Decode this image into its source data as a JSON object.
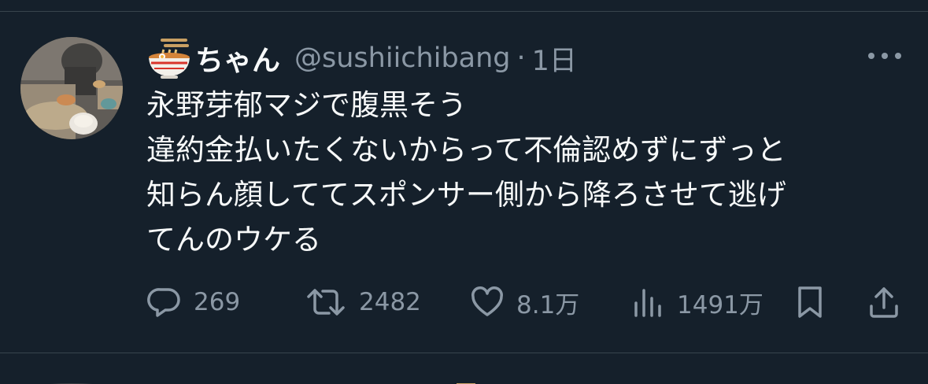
{
  "tweet": {
    "author": {
      "display_name": "ちゃん",
      "handle": "@sushiichibang",
      "name_emoji_icon": "ramen-bowl-icon"
    },
    "separator": "·",
    "time": "1日",
    "more_icon": "more-dots-icon",
    "lines": [
      "永野芽郁マジで腹黒そう",
      "違約金払いたくないからって不倫認めずにずっと",
      "知らん顔しててスポンサー側から降ろさせて逃げ",
      "てんのウケる"
    ]
  },
  "actions": {
    "reply": {
      "icon": "reply-icon",
      "count": "269"
    },
    "repost": {
      "icon": "repost-icon",
      "count": "2482"
    },
    "like": {
      "icon": "heart-icon",
      "count": "8.1万"
    },
    "views": {
      "icon": "views-chart-icon",
      "count": "1491万"
    },
    "bookmark": {
      "icon": "bookmark-icon"
    },
    "share": {
      "icon": "share-icon"
    }
  },
  "colors": {
    "background": "#15202b",
    "text_primary": "#f7f9f9",
    "text_secondary": "#8b98a5",
    "divider": "#38444d"
  }
}
